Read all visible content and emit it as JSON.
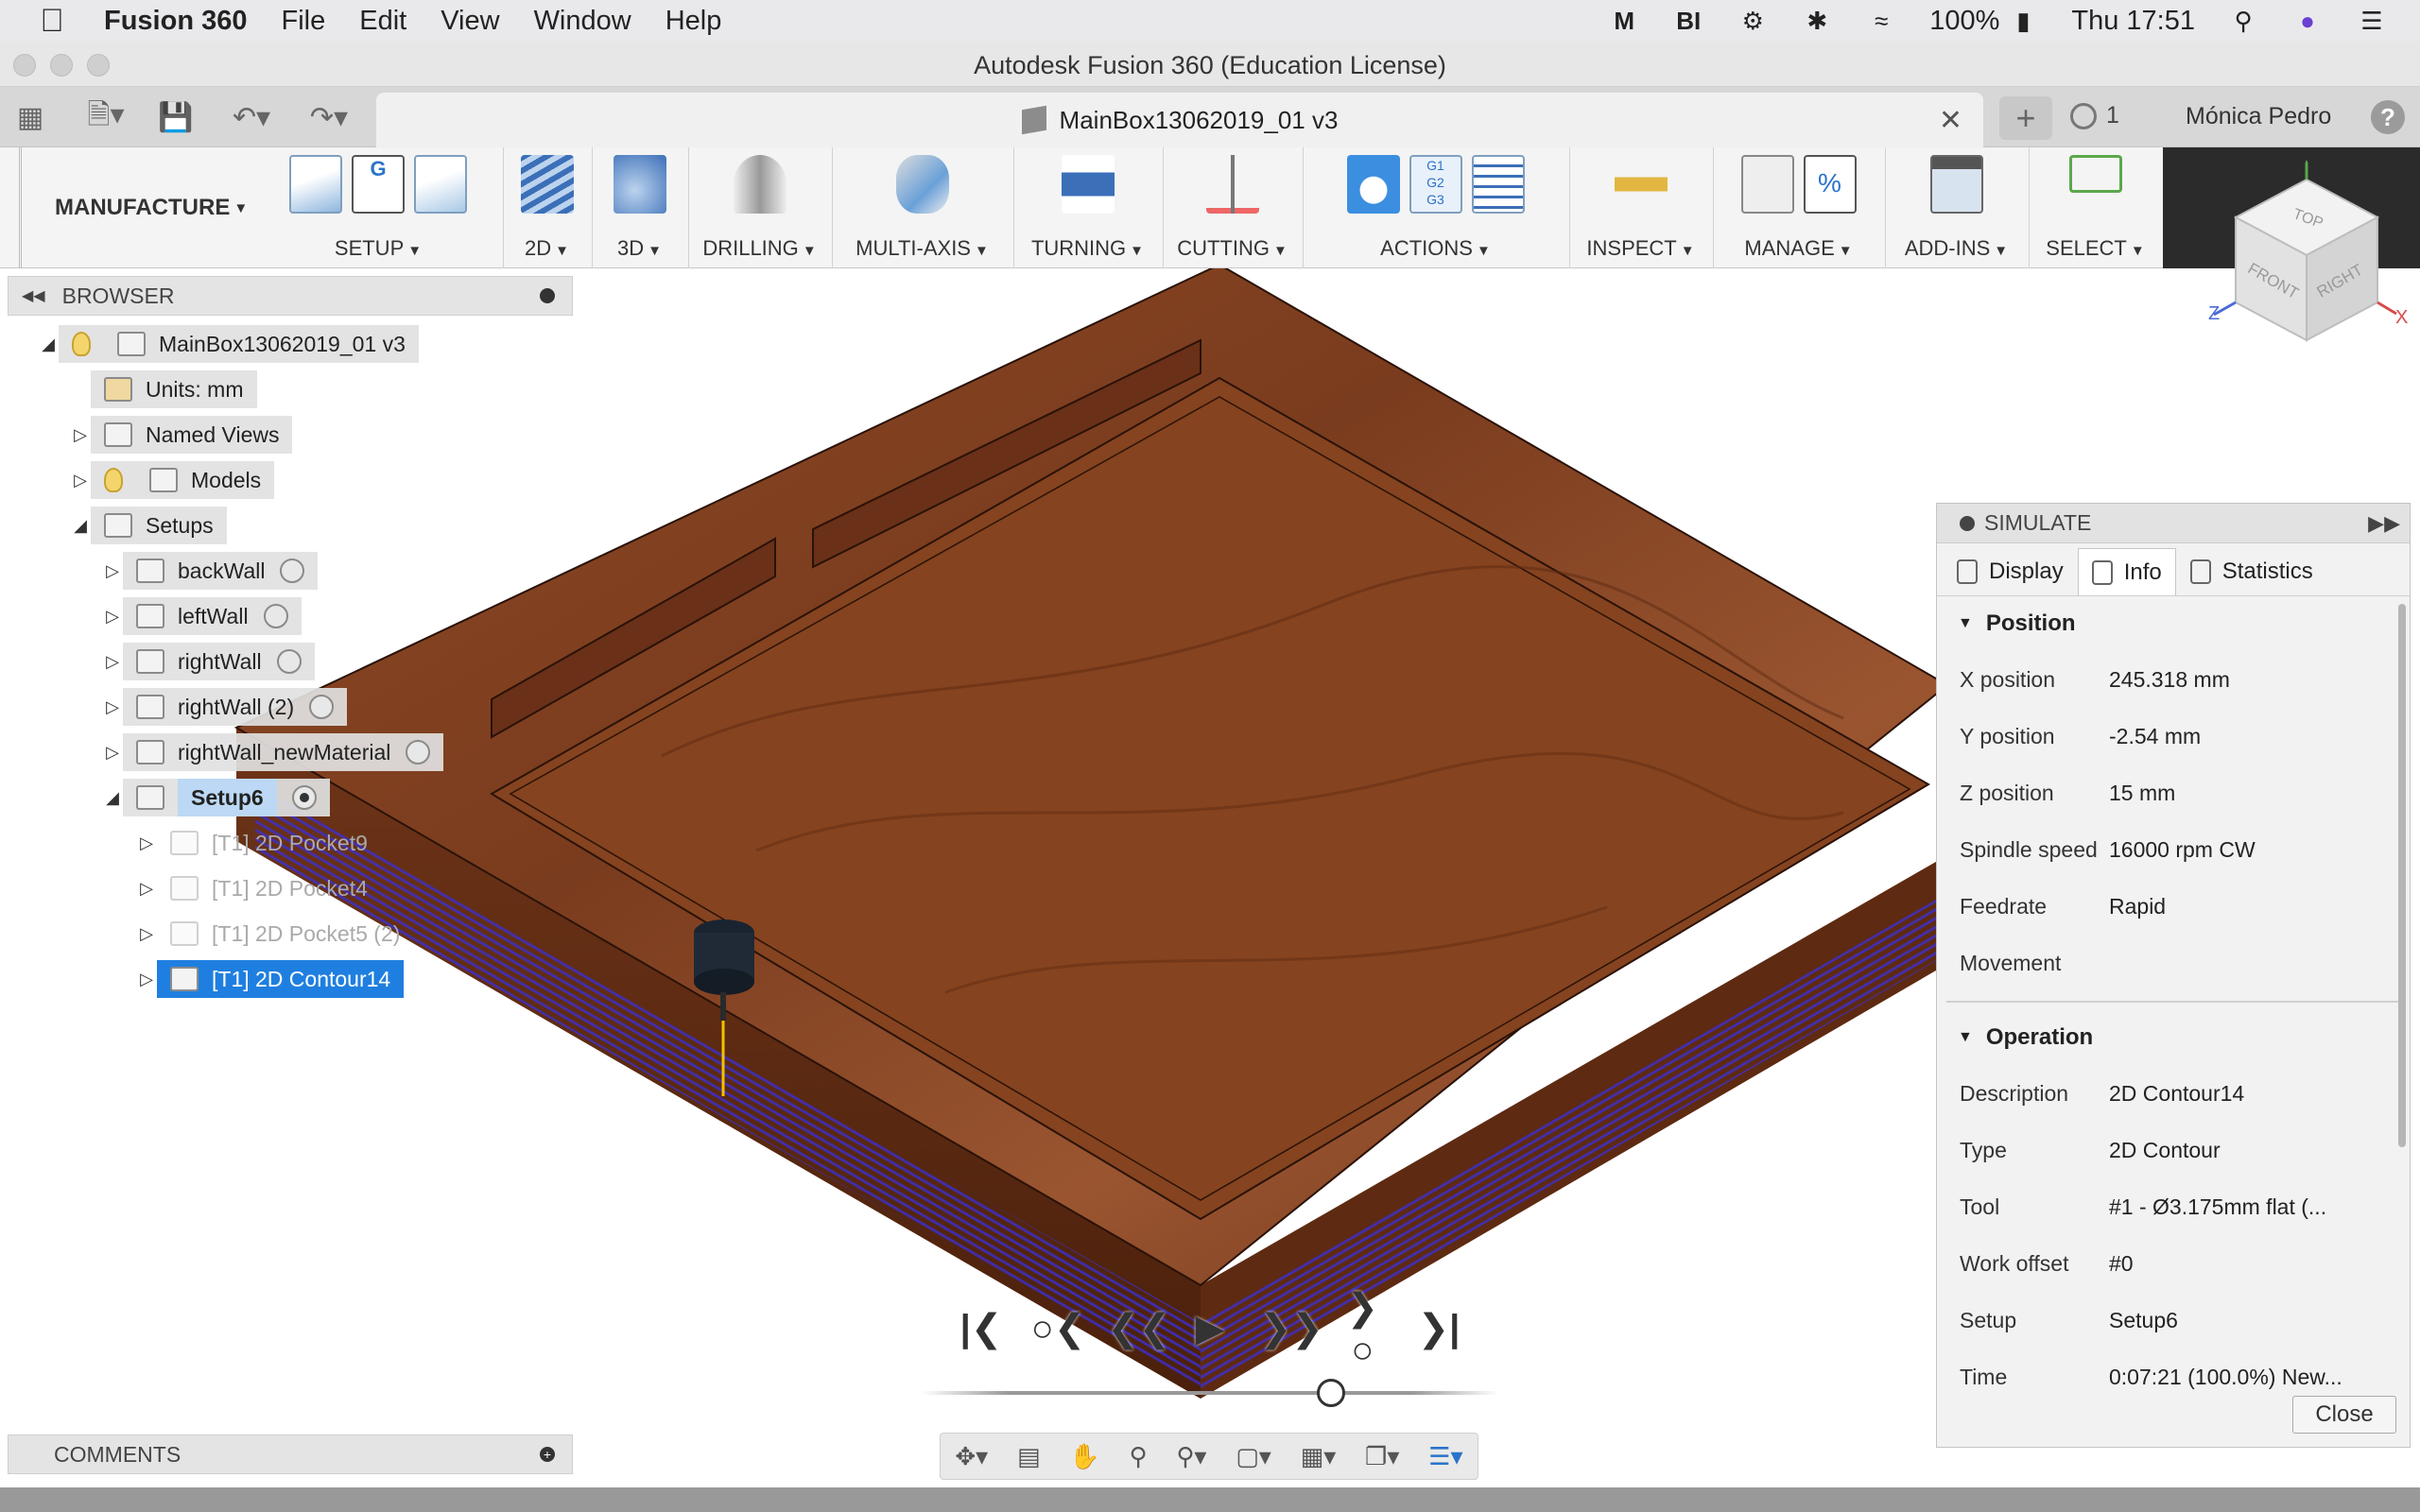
{
  "menubar": {
    "app_name": "Fusion 360",
    "items": [
      "File",
      "Edit",
      "View",
      "Window",
      "Help"
    ],
    "battery": "100%",
    "clock": "Thu 17:51",
    "icons": [
      "malwarebytes-icon",
      "bluetooth-icon",
      "wifi-icon",
      "battery-icon",
      "spotlight-icon",
      "siri-icon",
      "control-center-icon"
    ]
  },
  "window": {
    "title": "Autodesk Fusion 360 (Education License)"
  },
  "tabbar": {
    "doc_title": "MainBox13062019_01 v3",
    "jobs_count": "1",
    "user": "Mónica Pedro",
    "help": "?"
  },
  "ribbon": {
    "workspace": "MANUFACTURE",
    "groups": [
      "SETUP",
      "2D",
      "3D",
      "DRILLING",
      "MULTI-AXIS",
      "TURNING",
      "CUTTING",
      "ACTIONS",
      "INSPECT",
      "MANAGE",
      "ADD-INS",
      "SELECT"
    ]
  },
  "browser": {
    "title": "BROWSER",
    "root": "MainBox13062019_01 v3",
    "units": "Units: mm",
    "named_views": "Named Views",
    "models": "Models",
    "setups": "Setups",
    "setup_items": [
      "backWall",
      "leftWall",
      "rightWall",
      "rightWall (2)",
      "rightWall_newMaterial",
      "Setup6"
    ],
    "operations": [
      "[T1] 2D Pocket9",
      "[T1] 2D Pocket4",
      "[T1] 2D Pocket5 (2)",
      "[T1] 2D Contour14"
    ]
  },
  "comments": {
    "title": "COMMENTS"
  },
  "simulate": {
    "title": "SIMULATE",
    "tabs": [
      "Display",
      "Info",
      "Statistics"
    ],
    "active_tab": "Info",
    "position": {
      "title": "Position",
      "rows": [
        {
          "k": "X position",
          "v": "245.318 mm"
        },
        {
          "k": "Y position",
          "v": "-2.54 mm"
        },
        {
          "k": "Z position",
          "v": "15 mm"
        },
        {
          "k": "Spindle speed",
          "v": "16000 rpm CW"
        },
        {
          "k": "Feedrate",
          "v": "Rapid"
        },
        {
          "k": "Movement",
          "v": ""
        }
      ]
    },
    "operation": {
      "title": "Operation",
      "rows": [
        {
          "k": "Description",
          "v": "2D Contour14"
        },
        {
          "k": "Type",
          "v": "2D Contour"
        },
        {
          "k": "Tool",
          "v": "#1 - Ø3.175mm flat (..."
        },
        {
          "k": "Work offset",
          "v": "#0"
        },
        {
          "k": "Setup",
          "v": "Setup6"
        },
        {
          "k": "Time",
          "v": "0:07:21 (100.0%) New..."
        }
      ]
    },
    "close": "Close"
  },
  "playback": {
    "icons": [
      "go-to-start-icon",
      "previous-operation-icon",
      "step-back-icon",
      "play-icon",
      "step-forward-icon",
      "next-operation-icon",
      "go-to-end-icon"
    ],
    "progress": 0.71
  },
  "viewcube": {
    "top": "TOP",
    "front": "FRONT",
    "right": "RIGHT",
    "axis_y": "Y",
    "axis_z": "Z",
    "axis_x": "X"
  },
  "colors": {
    "wood": "#7a3a1c",
    "toolpath": "#3a2fd6",
    "selection": "#1f7fe0",
    "accent": "#3b8ee0"
  }
}
